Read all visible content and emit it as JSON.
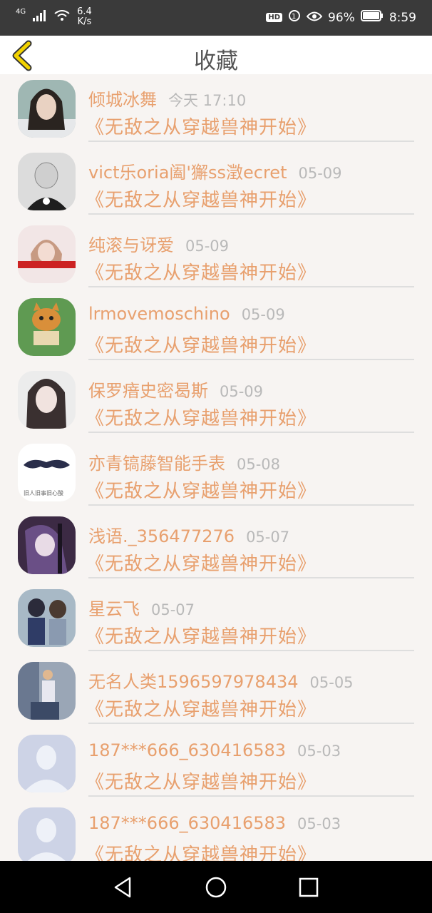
{
  "status_bar": {
    "network_type": "4G",
    "speed_value": "6.4",
    "speed_unit": "K/s",
    "hd_label": "HD",
    "battery": "96%",
    "time": "8:59",
    "icons": [
      "signal-icon",
      "wifi-icon",
      "hd-icon",
      "vibrate-icon",
      "eye-icon",
      "battery-icon"
    ]
  },
  "header": {
    "title": "收藏",
    "back_icon": "chevron-left-icon",
    "accent_color": "#f2d200"
  },
  "colors": {
    "accent_text": "#e8a06e",
    "date_text": "#b9b9b9",
    "background": "#f7f4f2"
  },
  "items": [
    {
      "name": "倾城冰舞",
      "date": "今天 17:10",
      "book": "《无敌之从穿越兽神开始》",
      "avatar": "photo-avatar"
    },
    {
      "name": "vict乐oria阖'獬ss澂ecret",
      "date": "05-09",
      "book": "《无敌之从穿越兽神开始》",
      "avatar": "photo-avatar"
    },
    {
      "name": "纯滚与讶爱",
      "date": "05-09",
      "book": "《无敌之从穿越兽神开始》",
      "avatar": "photo-avatar"
    },
    {
      "name": "lrmovemoschino",
      "date": "05-09",
      "book": "《无敌之从穿越兽神开始》",
      "avatar": "cartoon-cat-avatar"
    },
    {
      "name": "保罗瘖史密曷斯",
      "date": "05-09",
      "book": "《无敌之从穿越兽神开始》",
      "avatar": "photo-avatar"
    },
    {
      "name": "亦青镐藤智能手表",
      "date": "05-08",
      "book": "《无敌之从穿越兽神开始》",
      "avatar": "mustache-avatar",
      "avatar_caption": "旧人旧事旧心酸"
    },
    {
      "name": "浅语._356477276",
      "date": "05-07",
      "book": "《无敌之从穿越兽神开始》",
      "avatar": "anime-avatar"
    },
    {
      "name": "星云飞",
      "date": "05-07",
      "book": "《无敌之从穿越兽神开始》",
      "avatar": "anime-avatar"
    },
    {
      "name": "无名人类1596597978434",
      "date": "05-05",
      "book": "《无敌之从穿越兽神开始》",
      "avatar": "photo-avatar"
    },
    {
      "name": "187***666_630416583",
      "date": "05-03",
      "book": "《无敌之从穿越兽神开始》",
      "avatar": "default-avatar"
    },
    {
      "name": "187***666_630416583",
      "date": "05-03",
      "book": "《无敌之从穿越兽神开始》",
      "avatar": "default-avatar"
    }
  ],
  "nav_bar": {
    "buttons": [
      "back-triangle-icon",
      "home-circle-icon",
      "recents-square-icon"
    ]
  }
}
